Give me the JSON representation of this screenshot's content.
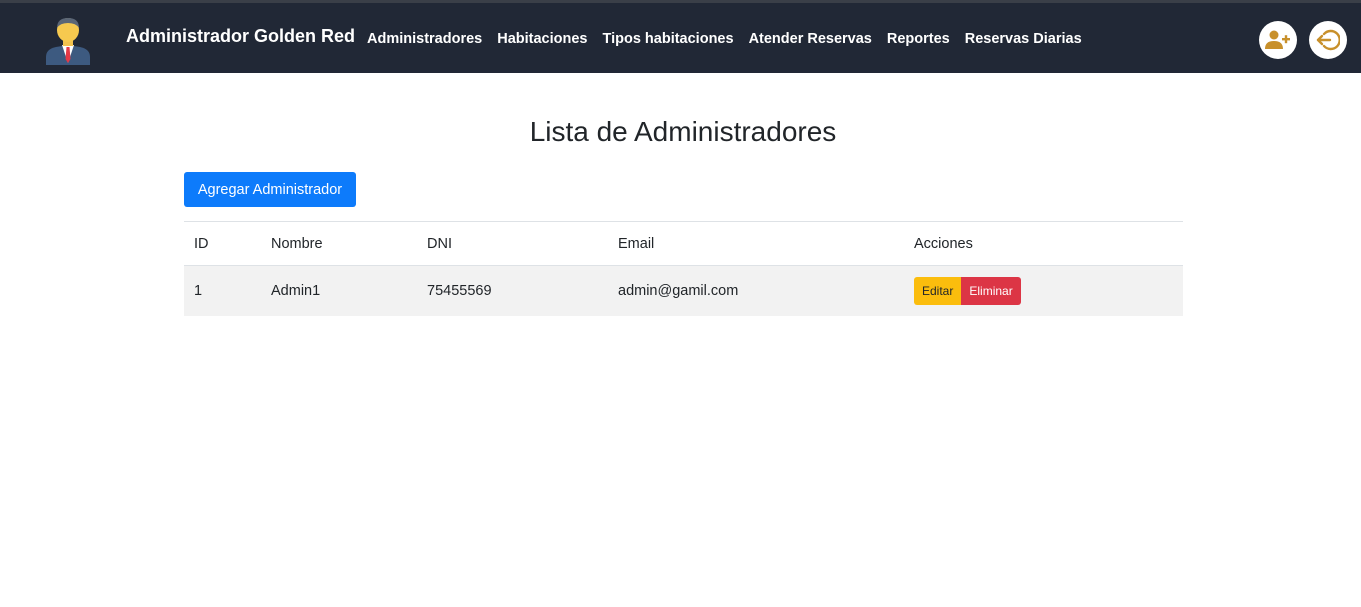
{
  "header": {
    "brand": "Administrador Golden Red",
    "nav": [
      "Administradores",
      "Habitaciones",
      "Tipos habitaciones",
      "Atender Reservas",
      "Reportes",
      "Reservas Diarias"
    ],
    "icons": {
      "add_user": "user-plus-icon",
      "logout": "logout-icon"
    },
    "colors": {
      "background": "#212836",
      "icon_accent": "#c8902b"
    }
  },
  "main": {
    "title": "Lista de Administradores",
    "add_button": "Agregar Administrador",
    "table": {
      "headers": [
        "ID",
        "Nombre",
        "DNI",
        "Email",
        "Acciones"
      ],
      "rows": [
        {
          "id": "1",
          "nombre": "Admin1",
          "dni": "75455569",
          "email": "admin@gamil.com",
          "edit": "Editar",
          "delete": "Eliminar"
        }
      ]
    }
  },
  "colors": {
    "primary": "#0d7bfb",
    "warning": "#fbbd0d",
    "danger": "#dc3545"
  }
}
